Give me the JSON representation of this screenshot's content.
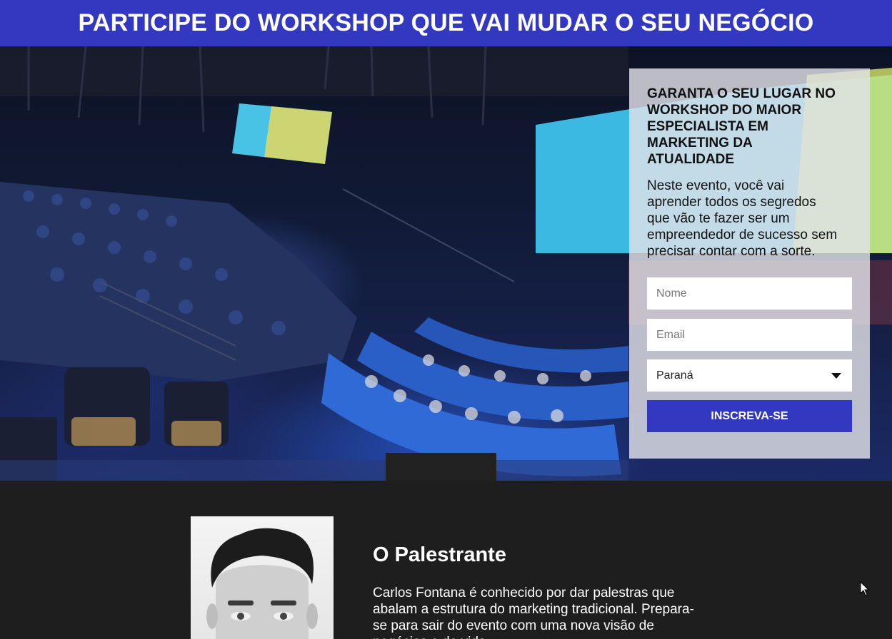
{
  "header": {
    "title": "PARTICIPE DO WORKSHOP QUE VAI MUDAR O SEU NEGÓCIO"
  },
  "hero": {
    "image": "conference-audience-photo"
  },
  "form": {
    "title": "GARANTA O SEU LUGAR NO WORKSHOP DO MAIOR ESPECIALISTA EM MARKETING DA ATUALIDADE",
    "description": "Neste evento, você vai aprender todos os segredos que vão te fazer ser um empreendedor de sucesso sem precisar contar com a sorte.",
    "name_placeholder": "Nome",
    "email_placeholder": "Email",
    "state_selected": "Paraná",
    "submit_label": "INSCREVA-SE"
  },
  "speaker": {
    "heading": "O Palestrante",
    "bio": "Carlos Fontana é conhecido por dar palestras que abalam a estrutura do marketing tradicional. Prepara-se para sair do evento com uma nova visão de negócios e de vida..."
  },
  "colors": {
    "brand": "#3238c0",
    "dark_bg": "#1e1e1e"
  }
}
